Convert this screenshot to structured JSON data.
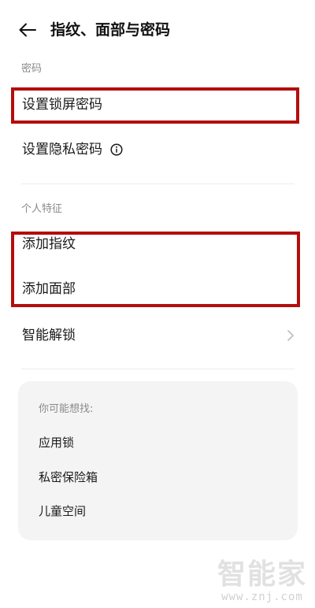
{
  "header": {
    "title": "指纹、面部与密码",
    "back_icon": "arrow-left-icon"
  },
  "sections": {
    "password": {
      "label": "密码",
      "items": [
        {
          "label": "设置锁屏密码",
          "highlighted": true
        },
        {
          "label": "设置隐私密码",
          "info_icon": "info-circle-icon"
        }
      ]
    },
    "personal": {
      "label": "个人特征",
      "items": [
        {
          "label": "添加指纹",
          "highlighted": true
        },
        {
          "label": "添加面部",
          "highlighted": true
        },
        {
          "label": "智能解锁",
          "trailing_icon": "chevron-right-icon"
        }
      ]
    }
  },
  "suggestions": {
    "title": "你可能想找:",
    "items": [
      "应用锁",
      "私密保险箱",
      "儿童空间"
    ]
  },
  "watermark": {
    "logo": "智能家",
    "url": "www.znj.com"
  },
  "colors": {
    "highlight": "#b40d0d",
    "card_bg": "#f4f4f4",
    "secondary_text": "#8a8a8a"
  }
}
